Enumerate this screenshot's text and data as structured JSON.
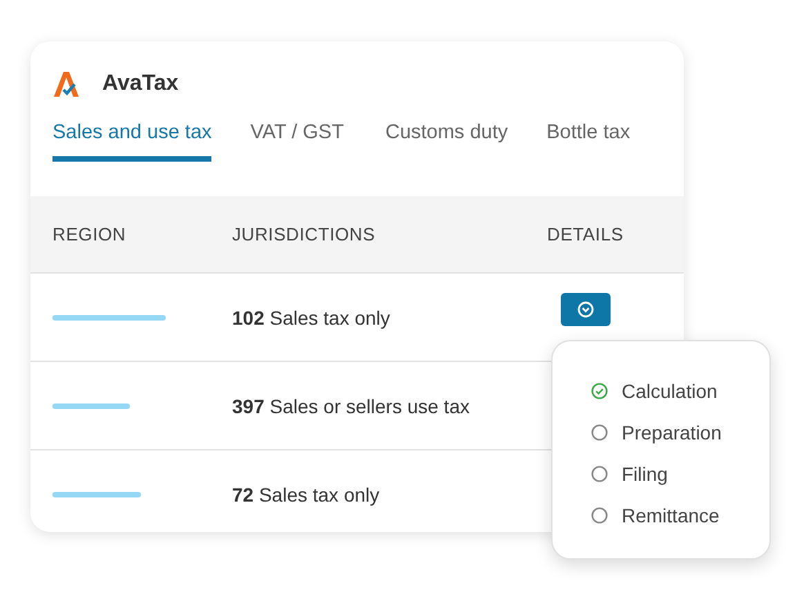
{
  "app": {
    "name": "AvaTax"
  },
  "tabs": [
    {
      "label": "Sales and use tax",
      "selected": true
    },
    {
      "label": "VAT / GST",
      "selected": false
    },
    {
      "label": "Customs duty",
      "selected": false
    },
    {
      "label": "Bottle tax",
      "selected": false
    }
  ],
  "table": {
    "columns": [
      "REGION",
      "JURISDICTIONS",
      "DETAILS"
    ],
    "rows": [
      {
        "jurisdictions": "**102** Sales tax only",
        "expanded": true
      },
      {
        "jurisdictions": "**397** Sales or sellers use tax"
      },
      {
        "jurisdictions": "**72** Sales tax only"
      }
    ]
  },
  "menu": {
    "items": [
      {
        "label": "Calculation",
        "checked": true
      },
      {
        "label": "Preparation",
        "checked": false
      },
      {
        "label": "Filing",
        "checked": false
      },
      {
        "label": "Remittance",
        "checked": false
      }
    ]
  }
}
